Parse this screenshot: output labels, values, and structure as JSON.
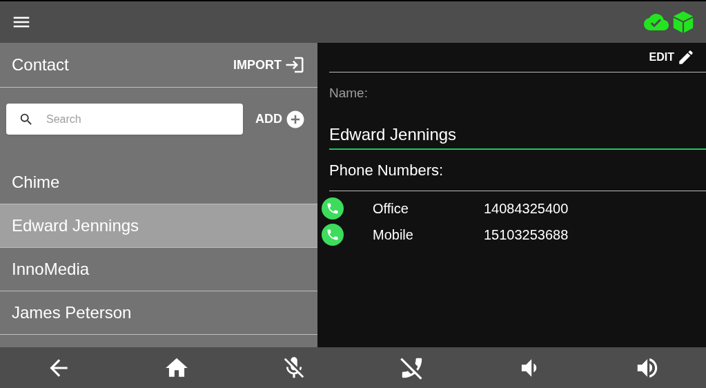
{
  "contacts_panel": {
    "title": "Contact",
    "import_label": "IMPORT",
    "search": {
      "placeholder": "Search"
    },
    "add_label": "ADD",
    "contacts": [
      {
        "name": "Chime",
        "selected": false
      },
      {
        "name": "Edward Jennings",
        "selected": true
      },
      {
        "name": "InnoMedia",
        "selected": false
      },
      {
        "name": "James Peterson",
        "selected": false
      }
    ]
  },
  "detail_panel": {
    "edit_label": "EDIT",
    "name_label": "Name:",
    "name_value": "Edward Jennings",
    "phones_label": "Phone Numbers:",
    "phones": [
      {
        "type": "Office",
        "number": "14084325400"
      },
      {
        "type": "Mobile",
        "number": "15103253688"
      }
    ]
  },
  "bottom_bar": [
    {
      "kind": "back"
    },
    {
      "kind": "home"
    },
    {
      "kind": "mic-off"
    },
    {
      "kind": "phone-off"
    },
    {
      "kind": "volume-down"
    },
    {
      "kind": "volume-up"
    }
  ]
}
